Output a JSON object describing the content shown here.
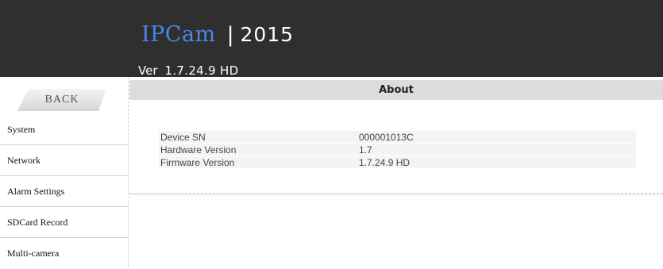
{
  "header": {
    "brand": "IPCam",
    "separator": "|",
    "year": "2015",
    "version_label": "Ver",
    "version_number": "1.7.24.9 HD"
  },
  "sidebar": {
    "back_label": "BACK",
    "items": [
      {
        "label": "System"
      },
      {
        "label": "Network"
      },
      {
        "label": "Alarm Settings"
      },
      {
        "label": "SDCard Record"
      },
      {
        "label": "Multi-camera"
      }
    ]
  },
  "about": {
    "title": "About",
    "rows": [
      {
        "label": "Device SN",
        "value": "000001013C"
      },
      {
        "label": "Hardware Version",
        "value": "1.7"
      },
      {
        "label": "Firmware Version",
        "value": "1.7.24.9 HD"
      }
    ]
  },
  "colors": {
    "header_bg": "#2f2f2f",
    "brand": "#4a86e8",
    "panel_header_bg": "#dcdcdc",
    "row_bg": "#f4f4f4"
  }
}
